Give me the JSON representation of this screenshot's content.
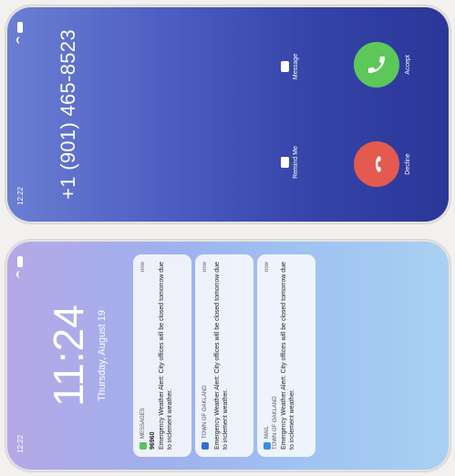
{
  "incoming_call": {
    "status_time": "12:22",
    "caller_number": "+1 (901) 465-8523",
    "actions": {
      "remind_me": "Remind Me",
      "message": "Message",
      "decline": "Decline",
      "accept": "Accept"
    }
  },
  "lock_screen": {
    "status_time": "12:22",
    "time": "11:24",
    "date": "Thursday, August 19",
    "notifications": [
      {
        "app": "MESSAGES",
        "time": "now",
        "sender": "96960",
        "body": "Emergency Weather Alert: City offices will be closed tomorrow due to inclement weather."
      },
      {
        "app": "TOWN OF OAKLAND",
        "time": "now",
        "body": "Emergency Weather Alert: City offices will be closed tomorrow due to inclement weather."
      },
      {
        "app": "MAIL",
        "time": "now",
        "subtitle": "TOWN OF OAKLAND",
        "body": "Emergency Weather Alert: City offices will be closed tomorrow due to inclement weather."
      }
    ]
  },
  "colors": {
    "decline": "#e45a4e",
    "accept": "#5dc75a",
    "messages_icon": "#56c45a",
    "gov_icon": "#2f6fd6",
    "mail_icon": "#3b8de0"
  }
}
